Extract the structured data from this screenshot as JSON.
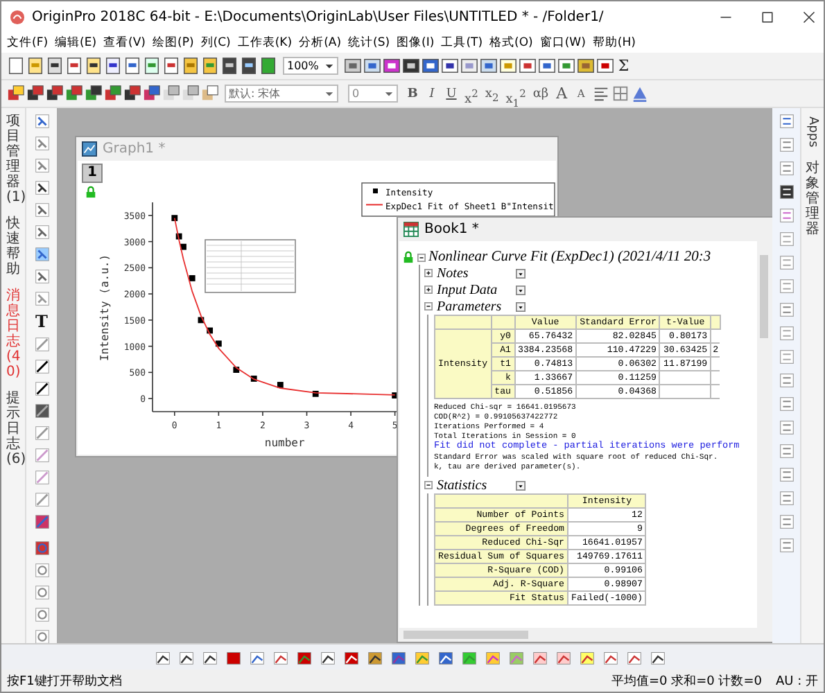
{
  "window": {
    "title": "OriginPro 2018C 64-bit - E:\\Documents\\OriginLab\\User Files\\UNTITLED * - /Folder1/"
  },
  "menu": [
    "文件(F)",
    "编辑(E)",
    "查看(V)",
    "绘图(P)",
    "列(C)",
    "工作表(K)",
    "分析(A)",
    "统计(S)",
    "图像(I)",
    "工具(T)",
    "格式(O)",
    "窗口(W)",
    "帮助(H)"
  ],
  "toolbar": {
    "zoom": "100%",
    "sum_button": "Σ"
  },
  "format_bar": {
    "font": "默认: 宋体",
    "size": "0",
    "buttons": [
      {
        "label": "B",
        "kind": "bold"
      },
      {
        "label": "I",
        "kind": "italic"
      },
      {
        "label": "U",
        "kind": "underline"
      },
      {
        "label": "x$^{2}$",
        "kind": "plain"
      },
      {
        "label": "x$_{2}$",
        "kind": "plain"
      },
      {
        "label": "x$_{1}$$^{2}$",
        "kind": "plain"
      },
      {
        "label": "αβ",
        "kind": "plain"
      },
      {
        "label": "A",
        "kind": "large"
      },
      {
        "label": "A",
        "kind": "small"
      }
    ]
  },
  "left_tabs": [
    {
      "label": "项目管理器 (1)",
      "alert": false
    },
    {
      "label": "快速帮助",
      "alert": false
    },
    {
      "label": "消息日志 (40)",
      "alert": true
    },
    {
      "label": "提示日志 (6)",
      "alert": false
    }
  ],
  "tools": {
    "text_tool": "T"
  },
  "right_tabs": [
    {
      "label": "Apps",
      "kind": "rotated"
    },
    {
      "label": "对象管理器",
      "kind": "stacked"
    }
  ],
  "graph": {
    "title": "Graph1 *",
    "page": "1",
    "chart_data": {
      "type": "scatter",
      "xlabel": "number",
      "ylabel": "Intensity (a.u.)",
      "x": [
        0,
        0.1,
        0.2,
        0.4,
        0.6,
        0.8,
        1,
        1.4,
        1.8,
        2.4,
        3.2,
        5
      ],
      "series": [
        {
          "name": "Intensity",
          "color": "#000000",
          "values": [
            3450,
            3100,
            2900,
            2300,
            1500,
            1300,
            1050,
            550,
            380,
            260,
            90,
            60
          ]
        },
        {
          "name": "ExpDec1 Fit of Sheet1 B\"Intensit",
          "type": "line",
          "color": "#e83030",
          "values": [
            3450,
            3030,
            2660,
            2050,
            1580,
            1230,
            960,
            590,
            370,
            200,
            110,
            70
          ]
        }
      ],
      "legend": true,
      "xlim": [
        -0.5,
        5.1
      ],
      "ylim": [
        -250,
        3750
      ],
      "xticks": [
        0,
        1,
        2,
        3,
        4,
        5
      ],
      "yticks": [
        0,
        500,
        1000,
        1500,
        2000,
        2500,
        3000,
        3500
      ]
    }
  },
  "book": {
    "title": "Book1 *",
    "report": "Nonlinear Curve Fit (ExpDec1) (2021/4/11 20:3",
    "sections": [
      {
        "label": "Notes",
        "expanded": false
      },
      {
        "label": "Input Data",
        "expanded": false
      },
      {
        "label": "Parameters",
        "expanded": true
      }
    ],
    "param_columns": [
      "Value",
      "Standard Error",
      "t-Value"
    ],
    "param_group": "Intensity",
    "params": [
      {
        "label": "y0",
        "value": "65.76432",
        "error": "82.02845",
        "t": "0.80173"
      },
      {
        "label": "A1",
        "value": "3384.23568",
        "error": "110.47229",
        "t": "30.63425",
        "column_5": "2"
      },
      {
        "label": "t1",
        "value": "0.74813",
        "error": "0.06302",
        "t": "11.87199"
      },
      {
        "label": "k",
        "value": "1.33667",
        "error": "0.11259"
      },
      {
        "label": "tau",
        "value": "0.51856",
        "error": "0.04368"
      }
    ],
    "notes": [
      {
        "text": "Reduced Chi-sqr = 16641.0195673",
        "kind": "plain"
      },
      {
        "text": "COD(R^2) = 0.99105637422772",
        "kind": "plain"
      },
      {
        "text": "Iterations Performed = 4",
        "kind": "plain"
      },
      {
        "text": "Total Iterations in Session = 0",
        "kind": "plain"
      },
      {
        "text": "Fit did not complete - partial iterations were perform",
        "kind": "warning"
      },
      {
        "text": "Standard Error was scaled with square root of reduced Chi-Sqr.",
        "kind": "plain"
      },
      {
        "text": "k, tau are derived parameter(s).",
        "kind": "plain"
      }
    ],
    "statistics": {
      "label": "Statistics",
      "expanded": true,
      "column": "Intensity",
      "rows": [
        {
          "label": "Number of Points",
          "value": "12"
        },
        {
          "label": "Degrees of Freedom",
          "value": "9"
        },
        {
          "label": "Reduced Chi-Sqr",
          "value": "16641.01957"
        },
        {
          "label": "Residual Sum of Squares",
          "value": "149769.17611"
        },
        {
          "label": "R-Square (COD)",
          "value": "0.99106"
        },
        {
          "label": "Adj. R-Square",
          "value": "0.98907"
        },
        {
          "label": "Fit Status",
          "value": "Failed(-1000)"
        }
      ]
    }
  },
  "status_bar": {
    "hint": "按F1键打开帮助文档",
    "stats": "平均值=0 求和=0 计数=0",
    "au": "AU : 开"
  }
}
